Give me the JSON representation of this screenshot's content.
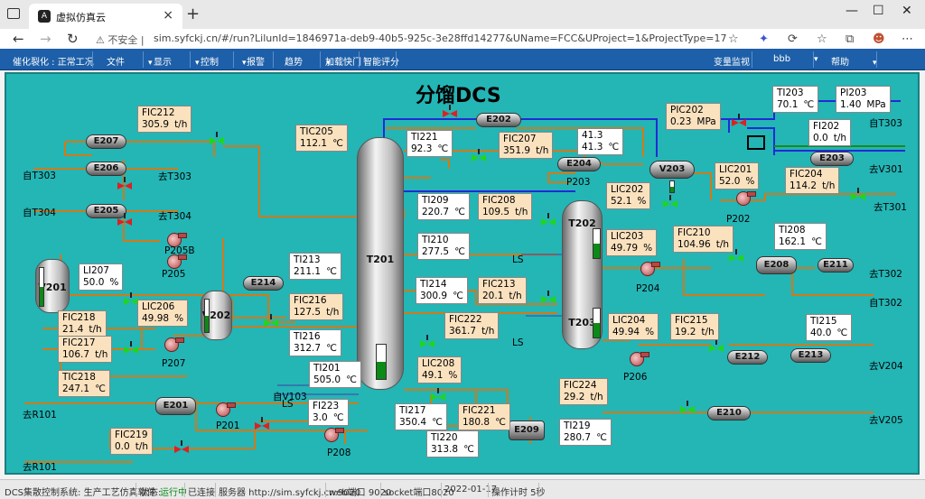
{
  "browser": {
    "tab_title": "虚拟仿真云",
    "not_secure": "不安全",
    "url": "sim.syfckj.cn/#/run?LilunId=1846971a-deb9-40b5-925c-3e28ffd14277&UName=FCC&UProject=1&ProjectType=17"
  },
  "menu": {
    "mode": "催化裂化 : 正常工况",
    "file": "文件",
    "display": "显示",
    "control": "控制",
    "alarm": "报警",
    "trend": "趋势",
    "speed": "加载快门",
    "score": "智能评分",
    "monitor": "变量监视",
    "user": "bbb",
    "help": "帮助"
  },
  "screen": {
    "title": "分馏DCS"
  },
  "tags": {
    "FIC212": {
      "name": "FIC212",
      "value": "305.9",
      "unit": "t/h"
    },
    "TIC205": {
      "name": "TIC205",
      "value": "112.1",
      "unit": "℃"
    },
    "TI221": {
      "name": "TI221",
      "value": "92.3",
      "unit": "℃"
    },
    "FIC207": {
      "name": "FIC207",
      "value": "351.9",
      "unit": "t/h"
    },
    "T41": {
      "name": "41.3",
      "value": "41.3",
      "unit": "℃"
    },
    "PIC202": {
      "name": "PIC202",
      "value": "0.23",
      "unit": "MPa"
    },
    "TI203": {
      "name": "TI203",
      "value": "70.1",
      "unit": "℃"
    },
    "PI203": {
      "name": "PI203",
      "value": "1.40",
      "unit": "MPa"
    },
    "FI202": {
      "name": "FI202",
      "value": "0.0",
      "unit": "t/h"
    },
    "LIC201": {
      "name": "LIC201",
      "value": "52.0",
      "unit": "%"
    },
    "FIC204": {
      "name": "FIC204",
      "value": "114.2",
      "unit": "t/h"
    },
    "LIC202": {
      "name": "LIC202",
      "value": "52.1",
      "unit": "%"
    },
    "TI209": {
      "name": "TI209",
      "value": "220.7",
      "unit": "℃"
    },
    "FIC208": {
      "name": "FIC208",
      "value": "109.5",
      "unit": "t/h"
    },
    "TI210": {
      "name": "TI210",
      "value": "277.5",
      "unit": "℃"
    },
    "LIC203": {
      "name": "LIC203",
      "value": "49.79",
      "unit": "%"
    },
    "FIC210": {
      "name": "FIC210",
      "value": "104.96",
      "unit": "t/h"
    },
    "TI208": {
      "name": "TI208",
      "value": "162.1",
      "unit": "℃"
    },
    "TI213": {
      "name": "TI213",
      "value": "211.1",
      "unit": "℃"
    },
    "LI207": {
      "name": "LI207",
      "value": "50.0",
      "unit": "%"
    },
    "TI214": {
      "name": "TI214",
      "value": "300.9",
      "unit": "℃"
    },
    "FIC213": {
      "name": "FIC213",
      "value": "20.1",
      "unit": "t/h"
    },
    "FIC216": {
      "name": "FIC216",
      "value": "127.5",
      "unit": "t/h"
    },
    "LIC206": {
      "name": "LIC206",
      "value": "49.98",
      "unit": "%"
    },
    "FIC218": {
      "name": "FIC218",
      "value": "21.4",
      "unit": "t/h"
    },
    "FIC217": {
      "name": "FIC217",
      "value": "106.7",
      "unit": "t/h"
    },
    "TI216": {
      "name": "TI216",
      "value": "312.7",
      "unit": "℃"
    },
    "FIC222": {
      "name": "FIC222",
      "value": "361.7",
      "unit": "t/h"
    },
    "LIC204": {
      "name": "LIC204",
      "value": "49.94",
      "unit": "%"
    },
    "FIC215": {
      "name": "FIC215",
      "value": "19.2",
      "unit": "t/h"
    },
    "TI215": {
      "name": "TI215",
      "value": "40.0",
      "unit": "℃"
    },
    "TIC218": {
      "name": "TIC218",
      "value": "247.1",
      "unit": "℃"
    },
    "TI201": {
      "name": "TI201",
      "value": "505.0",
      "unit": "℃"
    },
    "LIC208": {
      "name": "LIC208",
      "value": "49.1",
      "unit": "%"
    },
    "FIC224": {
      "name": "FIC224",
      "value": "29.2",
      "unit": "t/h"
    },
    "FI223": {
      "name": "FI223",
      "value": "3.0",
      "unit": "℃"
    },
    "TI217": {
      "name": "TI217",
      "value": "350.4",
      "unit": "℃"
    },
    "FIC221": {
      "name": "FIC221",
      "value": "180.8",
      "unit": "℃"
    },
    "TI219": {
      "name": "TI219",
      "value": "280.7",
      "unit": "℃"
    },
    "FIC219": {
      "name": "FIC219",
      "value": "0.0",
      "unit": "t/h"
    },
    "TI220": {
      "name": "TI220",
      "value": "313.8",
      "unit": "℃"
    }
  },
  "equipment": {
    "E207": "E207",
    "E206": "E206",
    "E205": "E205",
    "E202": "E202",
    "E204": "E204",
    "E203": "E203",
    "E214": "E214",
    "E208": "E208",
    "E211": "E211",
    "E201": "E201",
    "E209": "E209",
    "E210": "E210",
    "E212": "E212",
    "E213": "E213",
    "T201": "T201",
    "T202": "T202",
    "T203": "T203",
    "V201": "V201",
    "V202": "V202",
    "V203": "V203"
  },
  "labels": {
    "from_t303_a": "自T303",
    "to_t303": "去T303",
    "from_t304": "自T304",
    "to_t304": "去T304",
    "from_t303_b": "自T303",
    "to_v301": "去V301",
    "to_t301": "去T301",
    "to_t302": "去T302",
    "from_t302": "自T302",
    "to_v204": "去V204",
    "to_v205": "去V205",
    "to_r101_a": "去R101",
    "to_r101_b": "去R101",
    "from_v103": "自V103",
    "ls1": "LS",
    "ls2": "LS",
    "ls3": "LS",
    "ls4": "LS",
    "p205b": "P205B",
    "p205": "P205",
    "p207": "P207",
    "p201": "P201",
    "p208": "P208",
    "p202": "P202",
    "p204": "P204",
    "p206": "P206",
    "p203": "P203"
  },
  "levels": {
    "V201": 0.5,
    "T201_bottom": 0.49,
    "LIC202": 0.52,
    "LIC203": 0.5,
    "LIC204": 0.5,
    "V202": 0.5
  },
  "status": {
    "system": "DCS集散控制系统: 生产工艺仿真软件",
    "state_label": "状态:",
    "state": "运行中",
    "connected": "已连接",
    "server": "服务器 http://sim.syfckj.cn:9020",
    "web_port": "web端口 9020",
    "socket_port": "socket端口8020",
    "date": "2022-01-17",
    "timer": "操作计时 5秒"
  }
}
